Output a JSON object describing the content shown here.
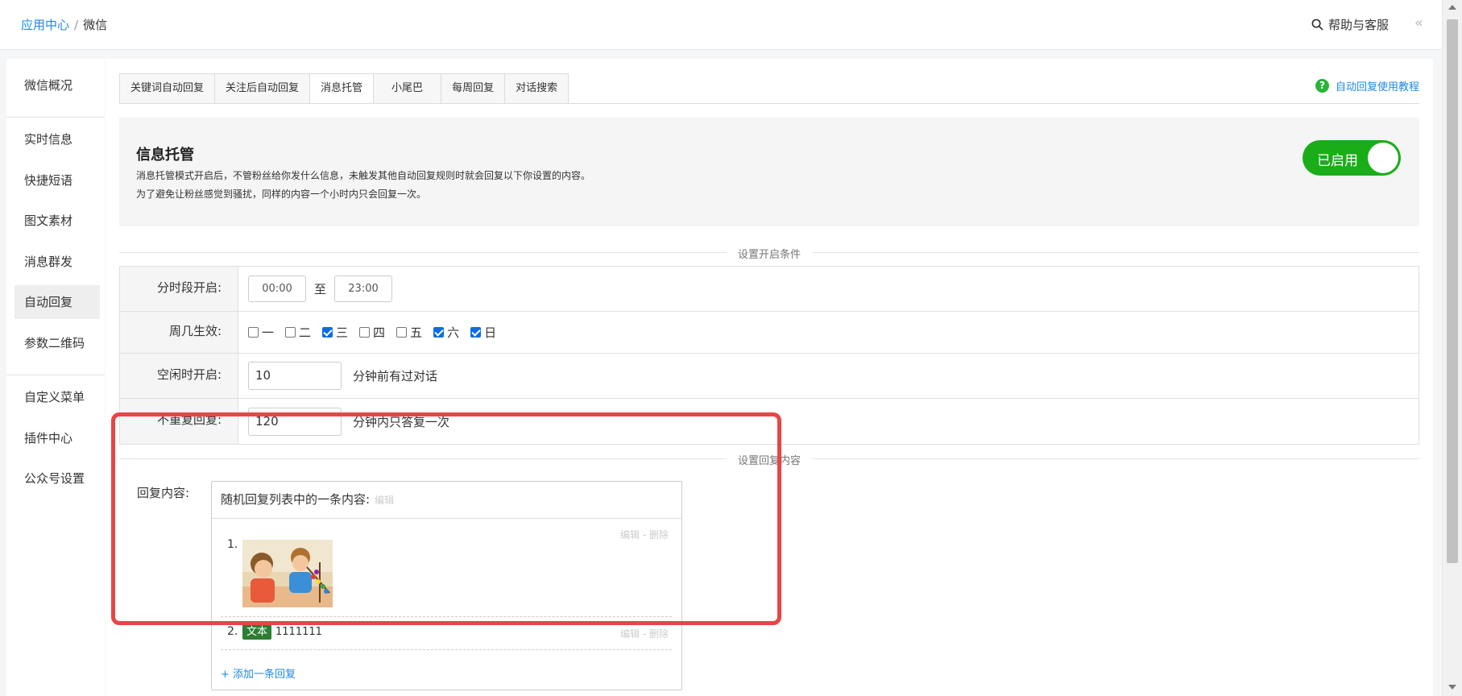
{
  "breadcrumb": {
    "root": "应用中心",
    "separator": "/",
    "current": "微信"
  },
  "header": {
    "help_label": "帮助与客服",
    "collapse_symbol": "«"
  },
  "sidebar": {
    "items": [
      {
        "label": "微信概况"
      },
      {
        "label": "实时信息"
      },
      {
        "label": "快捷短语"
      },
      {
        "label": "图文素材"
      },
      {
        "label": "消息群发"
      },
      {
        "label": "自动回复",
        "active": true
      },
      {
        "label": "参数二维码"
      },
      {
        "label": "自定义菜单"
      },
      {
        "label": "插件中心"
      },
      {
        "label": "公众号设置"
      }
    ]
  },
  "tabs": [
    {
      "label": "关键词自动回复"
    },
    {
      "label": "关注后自动回复"
    },
    {
      "label": "消息托管",
      "active": true
    },
    {
      "label": "小尾巴"
    },
    {
      "label": "每周回复"
    },
    {
      "label": "对话搜索"
    }
  ],
  "tutorial_link": "自动回复使用教程",
  "banner": {
    "title": "信息托管",
    "desc1": "消息托管模式开启后，不管粉丝给你发什么信息，未触发其他自动回复规则时就会回复以下你设置的内容。",
    "desc2": "为了避免让粉丝感觉到骚扰，同样的内容一个小时内只会回复一次。",
    "toggle_label": "已启用",
    "toggle_color": "#1aad19"
  },
  "sections": {
    "conditions": "设置开启条件",
    "content": "设置回复内容"
  },
  "conditions": {
    "time": {
      "label": "分时段开启:",
      "start": "00:00",
      "to": "至",
      "end": "23:00"
    },
    "weekdays": {
      "label": "周几生效:",
      "days": [
        {
          "label": "一",
          "checked": false
        },
        {
          "label": "二",
          "checked": false
        },
        {
          "label": "三",
          "checked": true
        },
        {
          "label": "四",
          "checked": false
        },
        {
          "label": "五",
          "checked": false
        },
        {
          "label": "六",
          "checked": true
        },
        {
          "label": "日",
          "checked": true
        }
      ]
    },
    "idle": {
      "label": "空闲时开启:",
      "value": "10",
      "suffix": "分钟前有过对话"
    },
    "norepeat": {
      "label": "不重复回复:",
      "value": "120",
      "suffix": "分钟内只答复一次"
    }
  },
  "reply": {
    "label": "回复内容:",
    "header": "随机回复列表中的一条内容:",
    "header_edit": "编辑",
    "items": [
      {
        "num": "1.",
        "type": "image",
        "actions": "编辑 - 删除"
      },
      {
        "num": "2.",
        "badge": "文本",
        "text": "1111111",
        "actions": "编辑 - 删除"
      }
    ],
    "add_label": "+ 添加一条回复"
  },
  "colors": {
    "link": "#1e88e5",
    "highlight": "#e84545",
    "badge": "#2e7d32"
  }
}
